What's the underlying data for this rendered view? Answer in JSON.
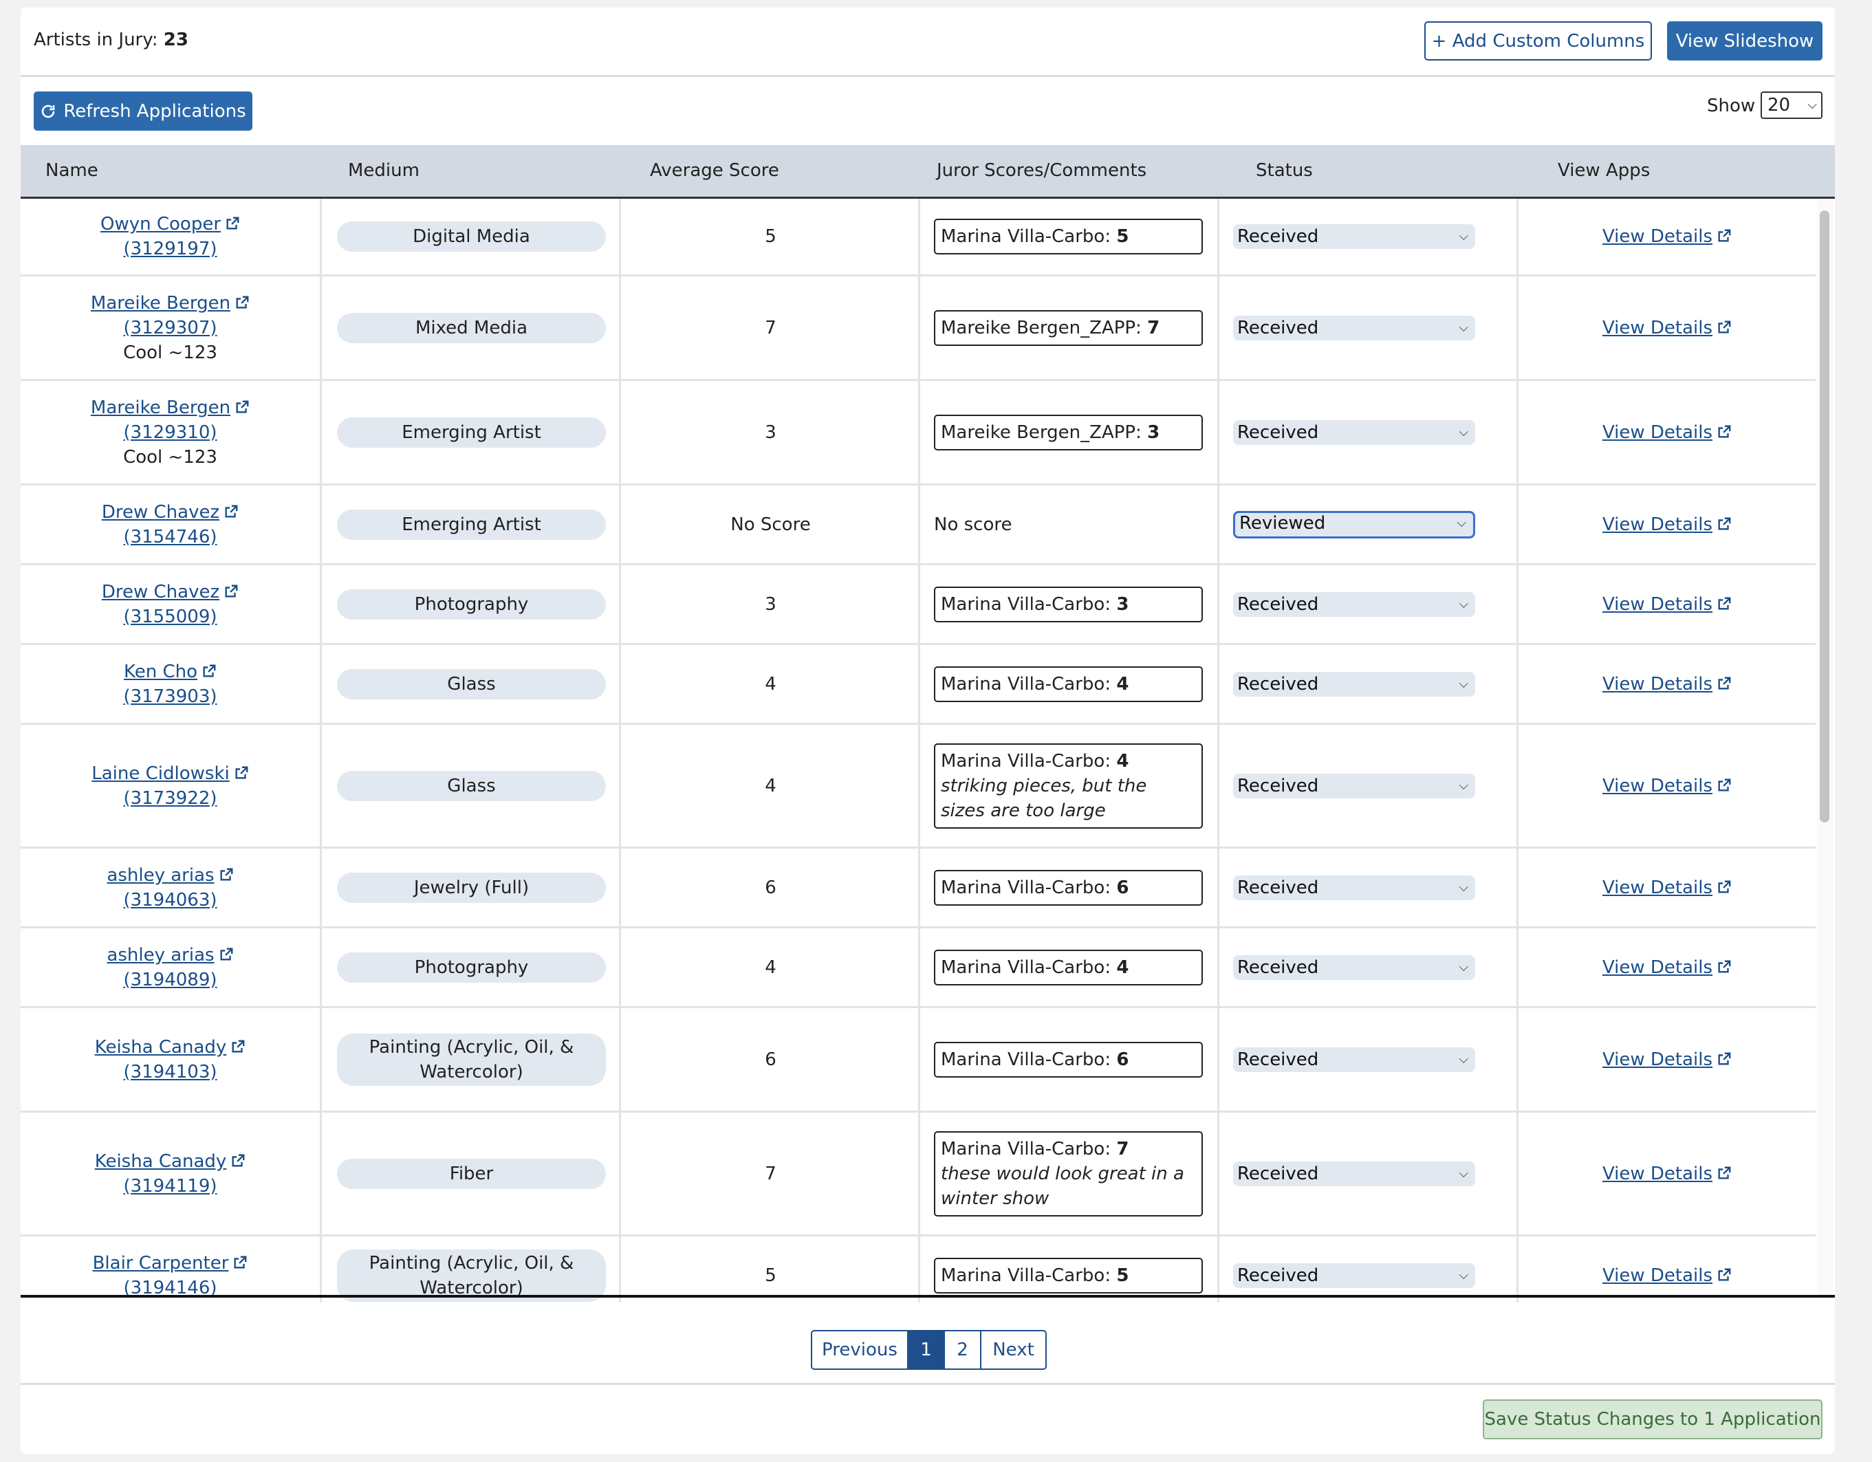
{
  "header": {
    "artists_label": "Artists in Jury:",
    "artists_count": "23",
    "add_columns_label": "+ Add Custom Columns",
    "slideshow_label": "View Slideshow"
  },
  "toolbar": {
    "refresh_label": "Refresh Applications",
    "show_label": "Show",
    "show_value": "20"
  },
  "table": {
    "columns": [
      "Name",
      "Medium",
      "Average Score",
      "Juror Scores/Comments",
      "Status",
      "View Apps"
    ],
    "view_details_label": "View Details",
    "rows": [
      {
        "name": "Owyn Cooper",
        "id": "(3129197)",
        "note": "",
        "medium": "Digital Media",
        "avg": "5",
        "juror": "Marina Villa-Carbo:",
        "score": "5",
        "comment": "",
        "status": "Received"
      },
      {
        "name": "Mareike Bergen",
        "id": "(3129307)",
        "note": "Cool ~123",
        "medium": "Mixed Media",
        "avg": "7",
        "juror": "Mareike Bergen_ZAPP:",
        "score": "7",
        "comment": "",
        "status": "Received"
      },
      {
        "name": "Mareike Bergen",
        "id": "(3129310)",
        "note": "Cool ~123",
        "medium": "Emerging Artist",
        "avg": "3",
        "juror": "Mareike Bergen_ZAPP:",
        "score": "3",
        "comment": "",
        "status": "Received"
      },
      {
        "name": "Drew Chavez",
        "id": "(3154746)",
        "note": "",
        "medium": "Emerging Artist",
        "avg": "No Score",
        "juror": "",
        "score": "",
        "comment": "",
        "no_score_text": "No score",
        "status": "Reviewed"
      },
      {
        "name": "Drew Chavez",
        "id": "(3155009)",
        "note": "",
        "medium": "Photography",
        "avg": "3",
        "juror": "Marina Villa-Carbo:",
        "score": "3",
        "comment": "",
        "status": "Received"
      },
      {
        "name": "Ken Cho",
        "id": "(3173903)",
        "note": "",
        "medium": "Glass",
        "avg": "4",
        "juror": "Marina Villa-Carbo:",
        "score": "4",
        "comment": "",
        "status": "Received"
      },
      {
        "name": "Laine Cidlowski",
        "id": "(3173922)",
        "note": "",
        "medium": "Glass",
        "avg": "4",
        "juror": "Marina Villa-Carbo:",
        "score": "4",
        "comment": "striking pieces, but the sizes are too large",
        "status": "Received"
      },
      {
        "name": "ashley arias",
        "id": "(3194063)",
        "note": "",
        "medium": "Jewelry (Full)",
        "avg": "6",
        "juror": "Marina Villa-Carbo:",
        "score": "6",
        "comment": "",
        "status": "Received"
      },
      {
        "name": "ashley arias",
        "id": "(3194089)",
        "note": "",
        "medium": "Photography",
        "avg": "4",
        "juror": "Marina Villa-Carbo:",
        "score": "4",
        "comment": "",
        "status": "Received"
      },
      {
        "name": "Keisha Canady",
        "id": "(3194103)",
        "note": "",
        "medium": "Painting (Acrylic, Oil, & Watercolor)",
        "avg": "6",
        "juror": "Marina Villa-Carbo:",
        "score": "6",
        "comment": "",
        "status": "Received"
      },
      {
        "name": "Keisha Canady",
        "id": "(3194119)",
        "note": "",
        "medium": "Fiber",
        "avg": "7",
        "juror": "Marina Villa-Carbo:",
        "score": "7",
        "comment": "these would look great in a winter show",
        "status": "Received"
      },
      {
        "name": "Blair Carpenter",
        "id": "(3194146)",
        "note": "",
        "medium": "Painting (Acrylic, Oil, & Watercolor)",
        "avg": "5",
        "juror": "Marina Villa-Carbo:",
        "score": "5",
        "comment": "",
        "status": "Received"
      }
    ]
  },
  "pagination": {
    "previous": "Previous",
    "pages": [
      "1",
      "2"
    ],
    "current": "1",
    "next": "Next"
  },
  "footer": {
    "save_label": "Save Status Changes to 1 Application"
  },
  "colors": {
    "primary": "#2c6aad",
    "link": "#1a4e8a",
    "header_bg": "#d3d9e2",
    "pill_bg": "#e2e8f0",
    "save_bg": "#d7e8d7"
  }
}
